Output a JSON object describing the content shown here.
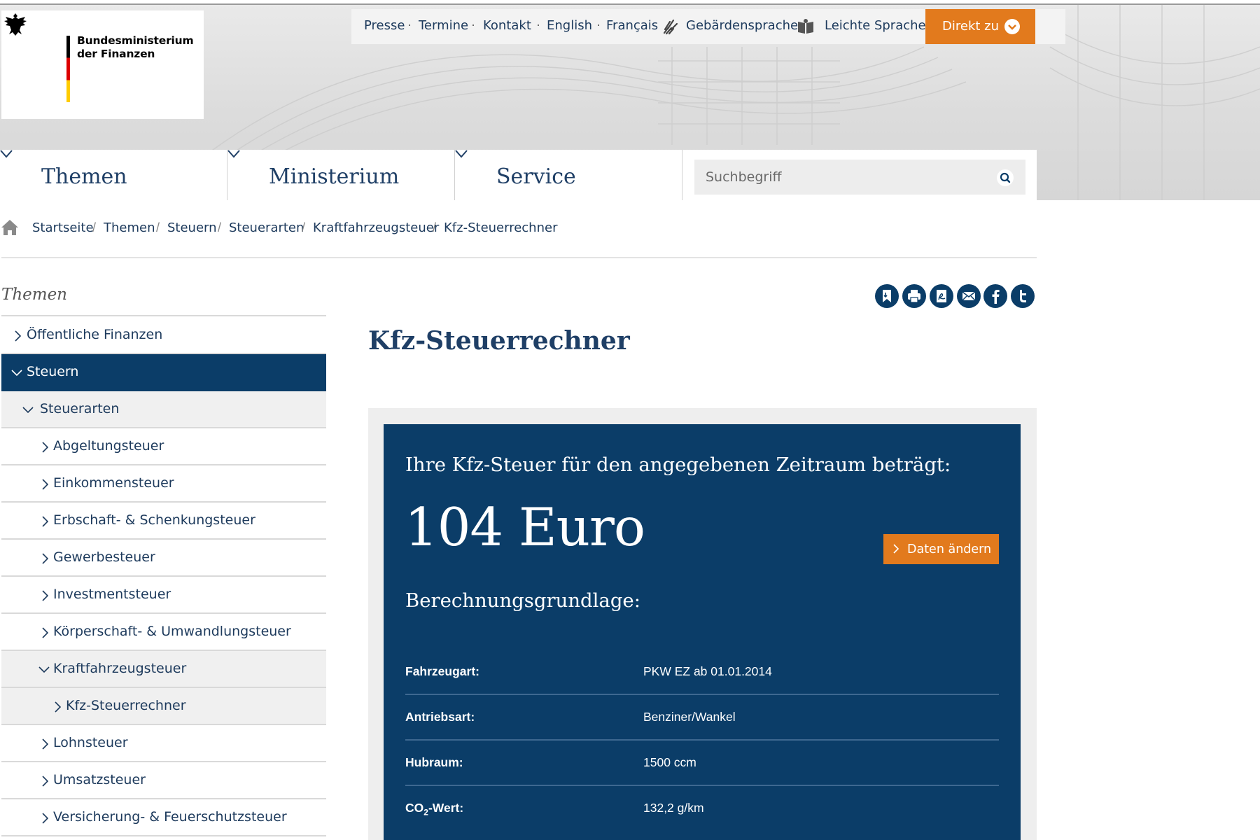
{
  "logo": {
    "line1": "Bundesministerium",
    "line2": "der Finanzen"
  },
  "meta_nav": {
    "presse": "Presse",
    "termine": "Termine",
    "kontakt": "Kontakt",
    "english": "English",
    "francais": "Français",
    "gebaerdensprache": "Gebärdensprache",
    "leichte_sprache": "Leichte Sprache",
    "direkt_zu": "Direkt zu"
  },
  "main_nav": {
    "themen": "Themen",
    "ministerium": "Ministerium",
    "service": "Service"
  },
  "search": {
    "placeholder": "Suchbegriff"
  },
  "breadcrumb": {
    "startseite": "Startseite",
    "themen": "Themen",
    "steuern": "Steuern",
    "steuerarten": "Steuerarten",
    "kraftfahrzeugsteuer": "Kraftfahrzeugsteuer",
    "current": "Kfz-Steuerrechner"
  },
  "sidebar": {
    "title": "Themen",
    "items": [
      {
        "label": "Öffentliche Finanzen"
      },
      {
        "label": "Steuern"
      },
      {
        "label": "Steuerarten"
      },
      {
        "label": "Abgeltungsteuer"
      },
      {
        "label": "Einkommensteuer"
      },
      {
        "label": "Erbschaft- & Schenkungsteuer"
      },
      {
        "label": "Gewerbesteuer"
      },
      {
        "label": "Investmentsteuer"
      },
      {
        "label": "Körperschaft- & Umwandlungsteuer"
      },
      {
        "label": "Kraftfahrzeugsteuer"
      },
      {
        "label": "Kfz-Steuerrechner"
      },
      {
        "label": "Lohnsteuer"
      },
      {
        "label": "Umsatzsteuer"
      },
      {
        "label": "Versicherung- & Feuerschutzsteuer"
      }
    ]
  },
  "share_icons": [
    "bookmark-icon",
    "print-icon",
    "pdf-icon",
    "mail-icon",
    "facebook-icon",
    "twitter-icon"
  ],
  "content": {
    "title": "Kfz-Steuerrechner",
    "result_intro": "Ihre Kfz-Steuer für den angegebenen Zeitraum beträgt:",
    "result_amount": "104 Euro",
    "change_button": "Daten ändern",
    "basis_heading": "Berechnungsgrundlage:",
    "basis_rows": [
      {
        "label": "Fahrzeugart:",
        "value": "PKW EZ ab 01.01.2014"
      },
      {
        "label": "Antriebsart:",
        "value": "Benziner/Wankel"
      },
      {
        "label": "Hubraum:",
        "value": "1500 ccm"
      },
      {
        "label_main": "CO",
        "label_sub": "2",
        "label_rest": "-Wert:",
        "value": "132,2 g/km"
      }
    ]
  },
  "colors": {
    "primary_blue": "#0b3d68",
    "accent_orange": "#e27a1d"
  }
}
